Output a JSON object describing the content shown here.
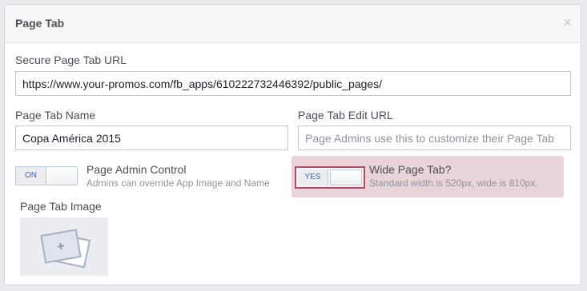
{
  "panel": {
    "title": "Page Tab",
    "close_label": "×"
  },
  "secure_url": {
    "label": "Secure Page Tab URL",
    "value": "https://www.your-promos.com/fb_apps/610222732446392/public_pages/"
  },
  "tab_name": {
    "label": "Page Tab Name",
    "value": "Copa América 2015"
  },
  "edit_url": {
    "label": "Page Tab Edit URL",
    "value": "",
    "placeholder": "Page Admins use this to customize their Page Tab"
  },
  "admin_control": {
    "toggle_label": "ON",
    "state": "on",
    "title": "Page Admin Control",
    "subtitle": "Admins can override App Image and Name"
  },
  "wide_tab": {
    "toggle_label": "YES",
    "state": "yes",
    "title": "Wide Page Tab?",
    "subtitle": "Standard width is 520px, wide is 810px.",
    "highlight_color": "#e9d4d9",
    "border_color": "#b24a66"
  },
  "tab_image": {
    "label": "Page Tab Image",
    "icon": "add-photo-icon"
  },
  "colors": {
    "accent": "#4267b2",
    "text": "#4b4f56",
    "muted": "#90949c"
  }
}
